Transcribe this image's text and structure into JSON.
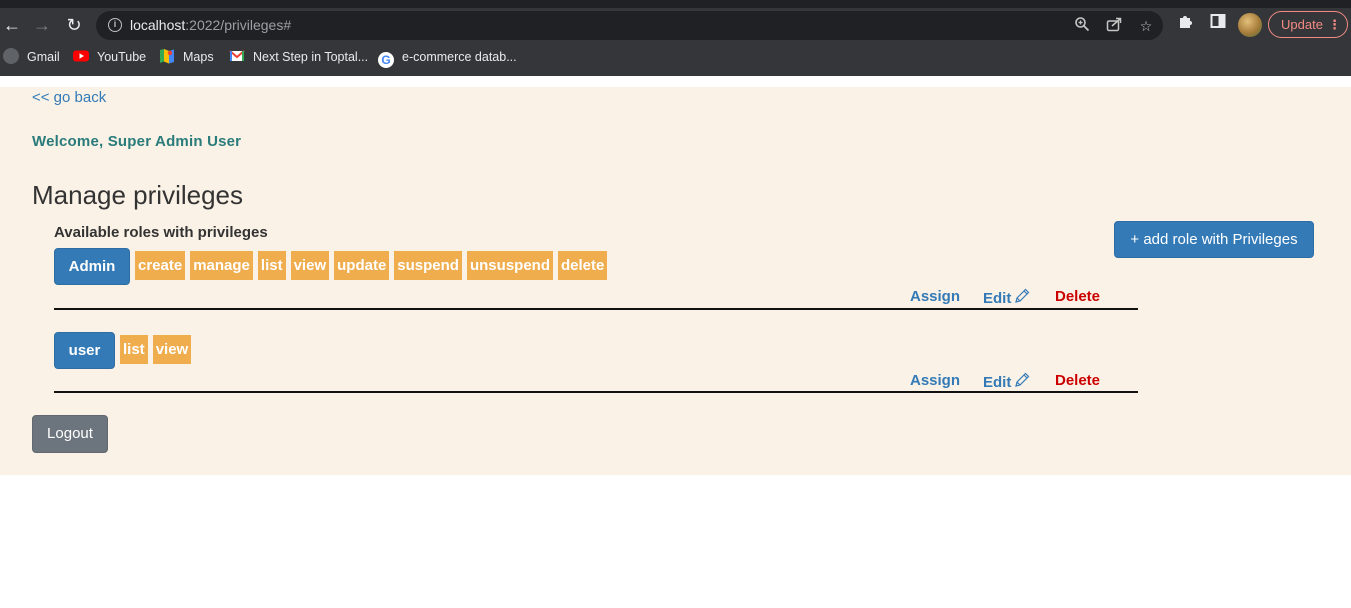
{
  "browser": {
    "url_host": "localhost",
    "url_path": ":2022/privileges#",
    "update_label": "Update",
    "bookmarks": [
      {
        "label": "Gmail",
        "icon": "globe-icon"
      },
      {
        "label": "YouTube",
        "icon": "youtube-icon"
      },
      {
        "label": "Maps",
        "icon": "maps-icon"
      },
      {
        "label": "Next Step in Toptal...",
        "icon": "gmail-icon"
      },
      {
        "label": "e-commerce datab...",
        "icon": "google-icon"
      }
    ]
  },
  "page": {
    "go_back": "<< go back",
    "welcome": "Welcome, Super Admin User",
    "title": "Manage privileges",
    "subtitle": "Available roles with privileges",
    "add_role_label": "+ add role with Privileges",
    "logout_label": "Logout",
    "roles": [
      {
        "name": "Admin",
        "privileges": [
          "create",
          "manage",
          "list",
          "view",
          "update",
          "suspend",
          "unsuspend",
          "delete"
        ],
        "assign_label": "Assign",
        "edit_label": "Edit",
        "delete_label": "Delete"
      },
      {
        "name": "user",
        "privileges": [
          "list",
          "view"
        ],
        "assign_label": "Assign",
        "edit_label": "Edit",
        "delete_label": "Delete"
      }
    ]
  },
  "colors": {
    "primary": "#337ab7",
    "privilege_badge": "#f0ad4e",
    "page_bg": "#faf2e6",
    "welcome": "#2a7b7b",
    "delete": "#cc0000",
    "logout": "#6c757d"
  }
}
